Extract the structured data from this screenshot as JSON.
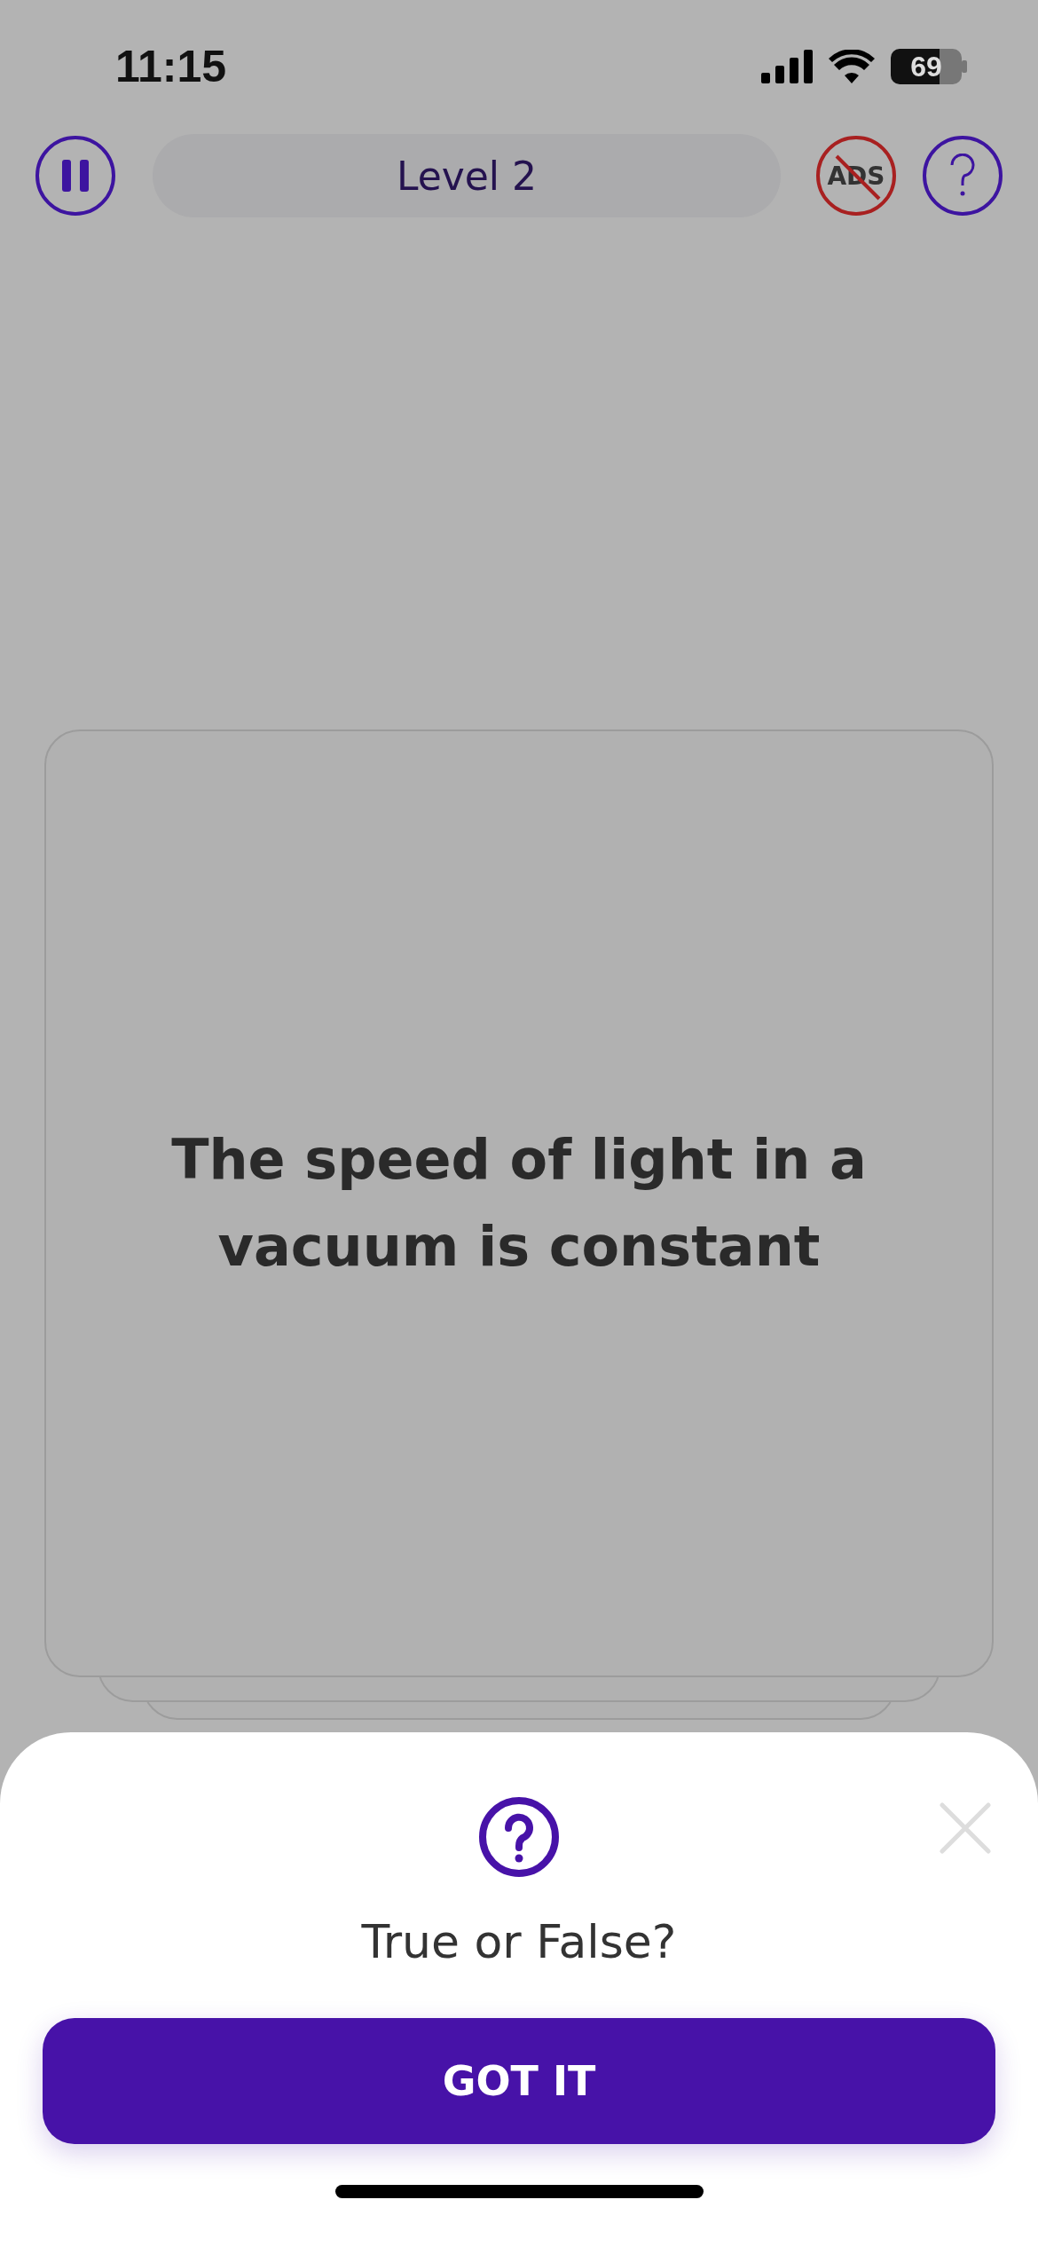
{
  "status_bar": {
    "time": "11:15",
    "battery": "69"
  },
  "top_bar": {
    "level_title": "Level 2",
    "no_ads_label": "ADS"
  },
  "card": {
    "statement": "The speed of light in a vacuum is constant"
  },
  "sheet": {
    "title": "True or False?",
    "button": "GOT IT"
  }
}
